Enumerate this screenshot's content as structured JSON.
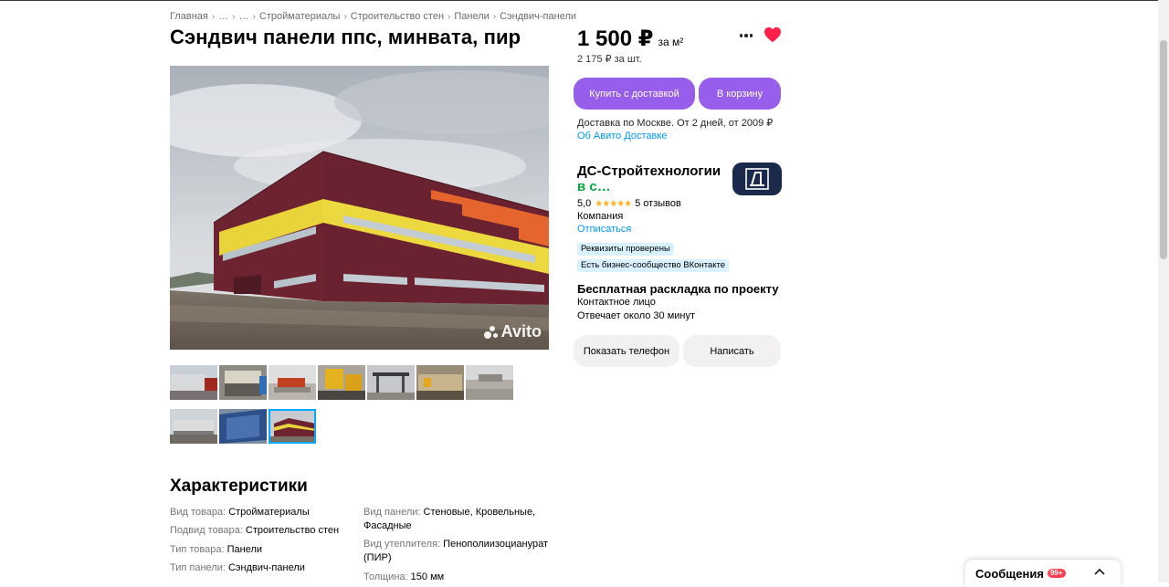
{
  "breadcrumbs": [
    "Главная",
    "…",
    "…",
    "Стройматериалы",
    "Строительство стен",
    "Панели",
    "Сэндвич-панели"
  ],
  "title": "Сэндвич панели ппс, минвата, пир",
  "gallery": {
    "watermark": "Avito",
    "thumbnail_count": 10,
    "active_index": 9
  },
  "price": {
    "value": "1 500 ₽",
    "unit": "за м²",
    "per_item": "2 175 ₽ за шт."
  },
  "icons": {
    "more": "more-dots-icon",
    "favorite": "heart-icon",
    "favorite_color": "#ff4053"
  },
  "buttons": {
    "buy_delivery": "Купить с доставкой",
    "add_to_cart": "В корзину",
    "show_phone": "Показать телефон",
    "write": "Написать"
  },
  "delivery": {
    "text": "Доставка по Москве. От 2 дней, от 2009 ₽",
    "link": "Об Авито Доставке"
  },
  "seller": {
    "name": "ДС-Стройтехнологии",
    "online": "в с…",
    "rating": "5,0",
    "stars": "★★★★★",
    "reviews": "5 отзывов",
    "type": "Компания",
    "unsubscribe": "Отписаться",
    "badges": [
      "Реквизиты проверены",
      "Есть бизнес-сообщество ВКонтакте"
    ],
    "logo_letter": "Д"
  },
  "promo": {
    "title": "Бесплатная раскладка по проекту",
    "contact": "Контактное лицо",
    "response": "Отвечает около 30 минут"
  },
  "characteristics": {
    "title": "Характеристики",
    "left": [
      {
        "k": "Вид товара: ",
        "v": "Стройматериалы"
      },
      {
        "k": "Подвид товара: ",
        "v": "Строительство стен"
      },
      {
        "k": "Тип товара: ",
        "v": "Панели"
      },
      {
        "k": "Тип панели: ",
        "v": "Сэндвич-панели"
      }
    ],
    "right": [
      {
        "k": "Вид панели: ",
        "v": "Стеновые, Кровельные, Фасадные"
      },
      {
        "k": "Вид утеплителя: ",
        "v": "Пенополиизоцианурат (ПИР)"
      },
      {
        "k": "Толщина: ",
        "v": "150 мм"
      }
    ]
  },
  "messages": {
    "label": "Сообщения",
    "count": "99+"
  },
  "colors": {
    "accent": "#965eeb",
    "link": "#0099f7",
    "online": "#02a83a",
    "badge_bg": "#d9f0fd"
  }
}
